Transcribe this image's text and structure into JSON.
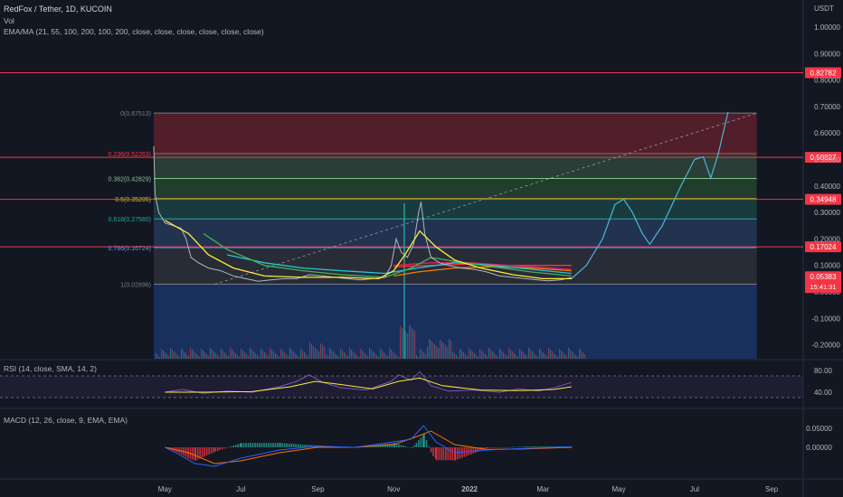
{
  "header": {
    "symbol": "RedFox / Tether, 1D, KUCOIN",
    "vol_label": "Vol",
    "ema_label": "EMA/MA (21, 55, 100, 200, 100, 200, close, close, close, close, close, close)",
    "currency": "USDT"
  },
  "rsi_label": "RSI (14, close, SMA, 14, 2)",
  "macd_label": "MACD (12, 26, close, 9, EMA, EMA)",
  "colors": {
    "bg": "#131722",
    "red_line": "#f23645",
    "fib_0": "#787b86",
    "fib_0236": "#f23645",
    "fib_0382": "#81c784",
    "fib_05": "#c0ca33",
    "fib_0618": "#26a69a",
    "fib_0786": "#5b9cf6",
    "fib_1": "#787b86",
    "projection": "#4db6d8",
    "price": "#b2b5be",
    "ema21": "#ffeb3b",
    "ema55": "#4caf50",
    "ema100": "#26c6da",
    "ema200": "#f57c00",
    "ma100": "#e91e63",
    "ma200": "#f23645",
    "rsi": "#7e57c2",
    "rsi_ma": "#ffeb3b",
    "macd": "#2962ff",
    "signal": "#ff6d00"
  },
  "chart_data": {
    "type": "line",
    "title": "RedFox / Tether, 1D, KUCOIN",
    "y_axis": {
      "ticks": [
        "1.00000",
        "0.90000",
        "0.80000",
        "0.70000",
        "0.60000",
        "0.50000",
        "0.40000",
        "0.30000",
        "0.20000",
        "0.10000",
        "0.00000",
        "-0.10000",
        "-0.20000"
      ],
      "ylim": [
        -0.25,
        1.05
      ]
    },
    "x_axis": {
      "ticks": [
        "May",
        "Jul",
        "Sep",
        "Nov",
        "2022",
        "Mar",
        "May",
        "Jul",
        "Sep"
      ]
    },
    "price_labels": [
      {
        "value": 0.82782,
        "text": "0.82782"
      },
      {
        "value": 0.50827,
        "text": "0.50827"
      },
      {
        "value": 0.34948,
        "text": "0.34948"
      },
      {
        "value": 0.17024,
        "text": "0.17024"
      }
    ],
    "last_price": {
      "value": 0.05383,
      "text": "0.05383",
      "countdown": "15:41:31"
    },
    "fib_levels": [
      {
        "ratio_label": "0(0.67513)",
        "value": 0.67513
      },
      {
        "ratio_label": "0.236(0.52263)",
        "value": 0.52263
      },
      {
        "ratio_label": "0.382(0.42829)",
        "value": 0.42829
      },
      {
        "ratio_label": "0.5(0.35205)",
        "value": 0.35205
      },
      {
        "ratio_label": "0.618(0.27580)",
        "value": 0.2758
      },
      {
        "ratio_label": "0.786(0.16724)",
        "value": 0.16724
      },
      {
        "ratio_label": "1(0.02896)",
        "value": 0.02896
      }
    ],
    "price_series": [
      [
        "2021-04-22",
        0.55
      ],
      [
        "2021-04-23",
        0.37
      ],
      [
        "2021-04-26",
        0.3
      ],
      [
        "2021-05-01",
        0.26
      ],
      [
        "2021-05-08",
        0.25
      ],
      [
        "2021-05-14",
        0.24
      ],
      [
        "2021-05-18",
        0.2
      ],
      [
        "2021-05-22",
        0.13
      ],
      [
        "2021-05-28",
        0.11
      ],
      [
        "2021-06-05",
        0.09
      ],
      [
        "2021-06-15",
        0.08
      ],
      [
        "2021-06-25",
        0.06
      ],
      [
        "2021-07-05",
        0.05
      ],
      [
        "2021-07-15",
        0.04
      ],
      [
        "2021-07-25",
        0.045
      ],
      [
        "2021-08-05",
        0.05
      ],
      [
        "2021-08-15",
        0.05
      ],
      [
        "2021-08-25",
        0.065
      ],
      [
        "2021-09-05",
        0.06
      ],
      [
        "2021-09-15",
        0.055
      ],
      [
        "2021-09-25",
        0.05
      ],
      [
        "2021-10-05",
        0.045
      ],
      [
        "2021-10-15",
        0.05
      ],
      [
        "2021-10-25",
        0.055
      ],
      [
        "2021-10-30",
        0.1
      ],
      [
        "2021-11-03",
        0.2
      ],
      [
        "2021-11-07",
        0.15
      ],
      [
        "2021-11-12",
        0.13
      ],
      [
        "2021-11-17",
        0.18
      ],
      [
        "2021-11-21",
        0.3
      ],
      [
        "2021-11-23",
        0.34
      ],
      [
        "2021-11-26",
        0.22
      ],
      [
        "2021-12-01",
        0.13
      ],
      [
        "2021-12-08",
        0.11
      ],
      [
        "2021-12-15",
        0.1
      ],
      [
        "2021-12-25",
        0.09
      ],
      [
        "2022-01-05",
        0.085
      ],
      [
        "2022-01-15",
        0.075
      ],
      [
        "2022-01-25",
        0.06
      ],
      [
        "2022-02-05",
        0.055
      ],
      [
        "2022-02-15",
        0.05
      ],
      [
        "2022-02-25",
        0.045
      ],
      [
        "2022-03-05",
        0.042
      ],
      [
        "2022-03-15",
        0.045
      ],
      [
        "2022-03-24",
        0.054
      ]
    ],
    "ema21": [
      [
        "2021-05-01",
        0.27
      ],
      [
        "2021-05-20",
        0.22
      ],
      [
        "2021-06-05",
        0.14
      ],
      [
        "2021-06-25",
        0.09
      ],
      [
        "2021-07-20",
        0.06
      ],
      [
        "2021-08-20",
        0.055
      ],
      [
        "2021-09-20",
        0.055
      ],
      [
        "2021-10-20",
        0.05
      ],
      [
        "2021-11-01",
        0.08
      ],
      [
        "2021-11-10",
        0.14
      ],
      [
        "2021-11-22",
        0.23
      ],
      [
        "2021-12-05",
        0.17
      ],
      [
        "2021-12-20",
        0.12
      ],
      [
        "2022-01-10",
        0.09
      ],
      [
        "2022-02-05",
        0.065
      ],
      [
        "2022-03-01",
        0.05
      ],
      [
        "2022-03-24",
        0.05
      ]
    ],
    "ema55": [
      [
        "2021-06-01",
        0.22
      ],
      [
        "2021-06-20",
        0.16
      ],
      [
        "2021-07-20",
        0.1
      ],
      [
        "2021-08-20",
        0.08
      ],
      [
        "2021-09-20",
        0.065
      ],
      [
        "2021-10-25",
        0.055
      ],
      [
        "2021-11-15",
        0.09
      ],
      [
        "2021-12-01",
        0.13
      ],
      [
        "2021-12-20",
        0.115
      ],
      [
        "2022-01-20",
        0.095
      ],
      [
        "2022-02-20",
        0.075
      ],
      [
        "2022-03-24",
        0.06
      ]
    ],
    "ema100": [
      [
        "2021-06-20",
        0.14
      ],
      [
        "2021-07-20",
        0.11
      ],
      [
        "2021-08-20",
        0.09
      ],
      [
        "2021-09-20",
        0.08
      ],
      [
        "2021-10-25",
        0.07
      ],
      [
        "2021-11-20",
        0.09
      ],
      [
        "2021-12-20",
        0.11
      ],
      [
        "2022-01-20",
        0.1
      ],
      [
        "2022-02-20",
        0.085
      ],
      [
        "2022-03-24",
        0.07
      ]
    ],
    "ema200": [
      [
        "2021-11-01",
        0.06
      ],
      [
        "2021-11-20",
        0.075
      ],
      [
        "2021-12-20",
        0.09
      ],
      [
        "2022-01-20",
        0.095
      ],
      [
        "2022-02-20",
        0.09
      ],
      [
        "2022-03-24",
        0.08
      ]
    ],
    "ma100": [
      [
        "2021-11-01",
        0.1
      ],
      [
        "2021-12-01",
        0.11
      ],
      [
        "2022-01-01",
        0.11
      ],
      [
        "2022-02-01",
        0.1
      ],
      [
        "2022-03-24",
        0.085
      ]
    ],
    "ma200": [
      [
        "2021-11-01",
        0.095
      ],
      [
        "2021-12-01",
        0.1
      ],
      [
        "2022-01-01",
        0.105
      ],
      [
        "2022-02-01",
        0.1
      ],
      [
        "2022-03-24",
        0.1
      ]
    ],
    "projection": [
      [
        "2022-03-24",
        0.05
      ],
      [
        "2022-04-05",
        0.1
      ],
      [
        "2022-04-18",
        0.2
      ],
      [
        "2022-04-28",
        0.33
      ],
      [
        "2022-05-05",
        0.35
      ],
      [
        "2022-05-12",
        0.3
      ],
      [
        "2022-05-20",
        0.22
      ],
      [
        "2022-05-26",
        0.18
      ],
      [
        "2022-06-05",
        0.25
      ],
      [
        "2022-06-20",
        0.4
      ],
      [
        "2022-07-01",
        0.5
      ],
      [
        "2022-07-08",
        0.51
      ],
      [
        "2022-07-14",
        0.43
      ],
      [
        "2022-07-20",
        0.52
      ],
      [
        "2022-07-28",
        0.68
      ]
    ],
    "trend_line": [
      [
        "2021-06-10",
        0.02896
      ],
      [
        "2022-08-20",
        0.67513
      ]
    ],
    "rsi": {
      "ticks": [
        "80.00",
        "40.00"
      ],
      "levels": [
        70,
        30
      ],
      "series": [
        [
          "2021-05-01",
          40
        ],
        [
          "2021-05-15",
          45
        ],
        [
          "2021-06-01",
          38
        ],
        [
          "2021-06-20",
          42
        ],
        [
          "2021-07-10",
          40
        ],
        [
          "2021-08-01",
          50
        ],
        [
          "2021-08-15",
          60
        ],
        [
          "2021-08-25",
          72
        ],
        [
          "2021-09-05",
          58
        ],
        [
          "2021-09-20",
          48
        ],
        [
          "2021-10-10",
          44
        ],
        [
          "2021-10-30",
          60
        ],
        [
          "2021-11-05",
          72
        ],
        [
          "2021-11-15",
          62
        ],
        [
          "2021-11-22",
          78
        ],
        [
          "2021-12-01",
          52
        ],
        [
          "2021-12-15",
          42
        ],
        [
          "2022-01-05",
          44
        ],
        [
          "2022-01-25",
          40
        ],
        [
          "2022-02-10",
          46
        ],
        [
          "2022-02-25",
          42
        ],
        [
          "2022-03-10",
          48
        ],
        [
          "2022-03-24",
          58
        ]
      ],
      "ma": [
        [
          "2021-05-01",
          40
        ],
        [
          "2021-06-01",
          40
        ],
        [
          "2021-07-10",
          41
        ],
        [
          "2021-08-10",
          50
        ],
        [
          "2021-08-30",
          60
        ],
        [
          "2021-09-20",
          54
        ],
        [
          "2021-10-15",
          46
        ],
        [
          "2021-11-05",
          60
        ],
        [
          "2021-11-22",
          66
        ],
        [
          "2021-12-10",
          52
        ],
        [
          "2022-01-10",
          44
        ],
        [
          "2022-02-10",
          43
        ],
        [
          "2022-03-10",
          45
        ],
        [
          "2022-03-24",
          50
        ]
      ]
    },
    "macd": {
      "ticks": [
        "0.05000",
        "0.00000"
      ],
      "macd_series": [
        [
          "2021-05-01",
          0.0
        ],
        [
          "2021-05-10",
          -0.01
        ],
        [
          "2021-05-25",
          -0.03
        ],
        [
          "2021-06-10",
          -0.035
        ],
        [
          "2021-07-01",
          -0.02
        ],
        [
          "2021-08-01",
          -0.005
        ],
        [
          "2021-09-01",
          0.002
        ],
        [
          "2021-10-01",
          0.0
        ],
        [
          "2021-11-01",
          0.01
        ],
        [
          "2021-11-15",
          0.015
        ],
        [
          "2021-11-25",
          0.04
        ],
        [
          "2021-12-05",
          0.01
        ],
        [
          "2021-12-20",
          -0.01
        ],
        [
          "2022-01-15",
          -0.005
        ],
        [
          "2022-02-15",
          -0.002
        ],
        [
          "2022-03-24",
          0.001
        ]
      ],
      "signal_series": [
        [
          "2021-05-01",
          0.0
        ],
        [
          "2021-05-20",
          -0.01
        ],
        [
          "2021-06-10",
          -0.03
        ],
        [
          "2021-07-01",
          -0.025
        ],
        [
          "2021-08-01",
          -0.01
        ],
        [
          "2021-09-01",
          0.0
        ],
        [
          "2021-10-01",
          0.0
        ],
        [
          "2021-11-01",
          0.005
        ],
        [
          "2021-11-20",
          0.02
        ],
        [
          "2021-12-01",
          0.03
        ],
        [
          "2021-12-20",
          0.005
        ],
        [
          "2022-01-15",
          -0.004
        ],
        [
          "2022-02-15",
          -0.003
        ],
        [
          "2022-03-24",
          0.0
        ]
      ]
    }
  }
}
